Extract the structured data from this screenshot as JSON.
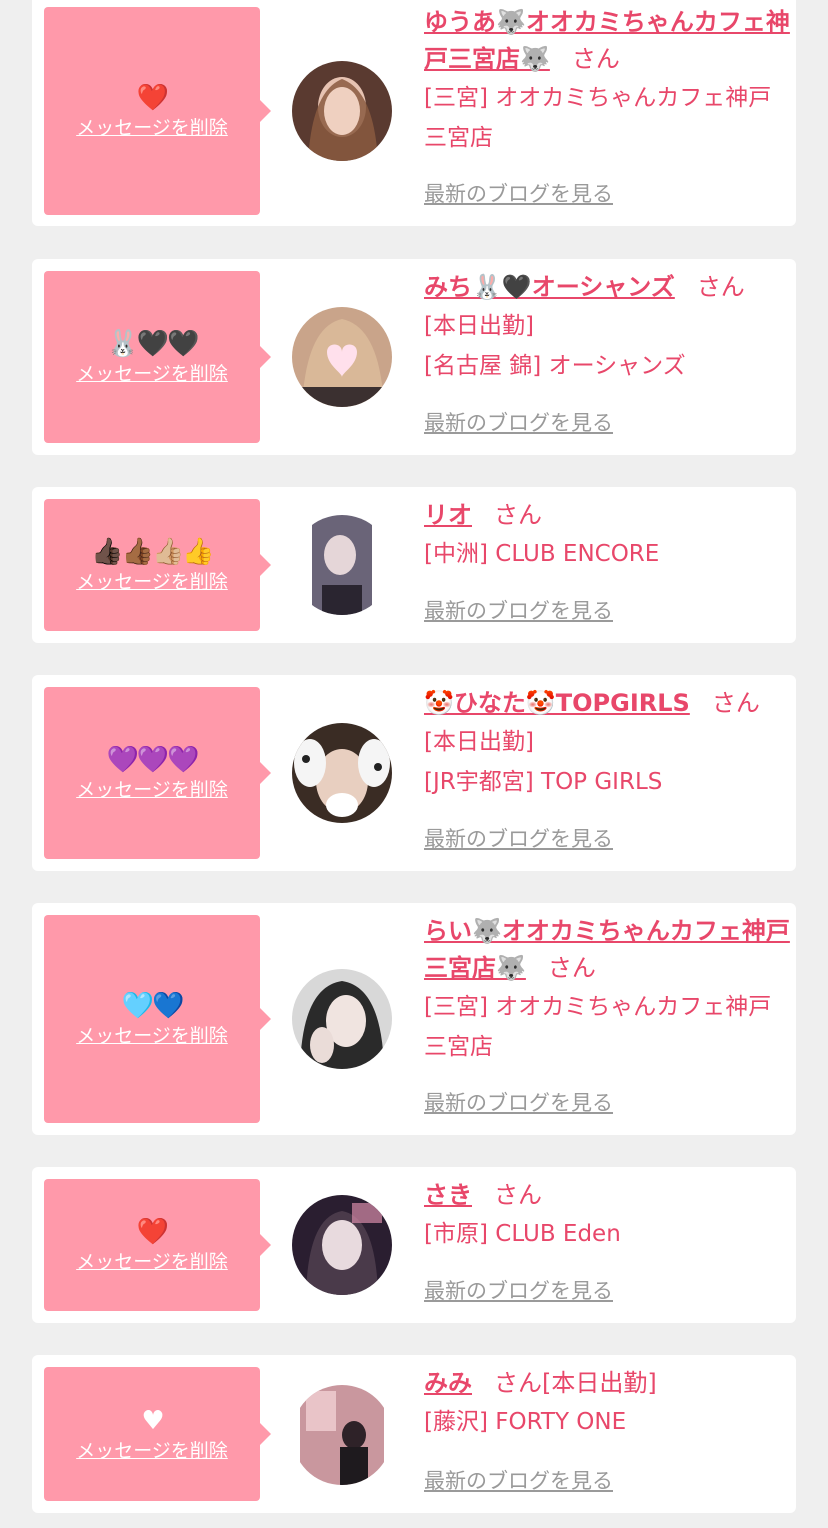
{
  "common": {
    "delete_label": "メッセージを削除",
    "san_label": "さん",
    "blog_label": "最新のブログを見る"
  },
  "entries": [
    {
      "emoji": "❤️",
      "name": "ゆうあ🐺オオカミちゃんカフェ神戸三宮店🐺",
      "name_suffix": "",
      "details": [
        "[三宮] オオカミちゃんカフェ神戸三宮店"
      ],
      "avatar_color": "#5a3a30"
    },
    {
      "emoji": "🐰🖤🖤",
      "name": "みち🐰🖤オーシャンズ",
      "name_suffix": "",
      "details": [
        "[本日出勤]",
        "[名古屋 錦] オーシャンズ"
      ],
      "avatar_color": "#c9a48a"
    },
    {
      "emoji": "👍🏿👍🏾👍🏼👍",
      "name": "リオ",
      "name_suffix": "",
      "details": [
        "[中洲] CLUB ENCORE"
      ],
      "avatar_color": "#7a7485"
    },
    {
      "emoji": "💜💜💜",
      "name": "🤡ひなた🤡TOPGIRLS",
      "name_suffix": "",
      "details": [
        "[本日出勤]",
        "[JR宇都宮] TOP GIRLS"
      ],
      "avatar_color": "#3a2c24"
    },
    {
      "emoji": "🩵💙",
      "name": "らい🐺オオカミちゃんカフェ神戸三宮店🐺",
      "name_suffix": "",
      "details": [
        "[三宮] オオカミちゃんカフェ神戸三宮店"
      ],
      "avatar_color": "#9a9a9a"
    },
    {
      "emoji": "❤️",
      "name": "さき",
      "name_suffix": "",
      "details": [
        "[市原] CLUB Eden"
      ],
      "avatar_color": "#3a2a40"
    },
    {
      "emoji": "♥",
      "name": "みみ",
      "name_suffix": "[本日出勤]",
      "details": [
        "[藤沢] FORTY ONE"
      ],
      "avatar_color": "#c9979e"
    }
  ]
}
